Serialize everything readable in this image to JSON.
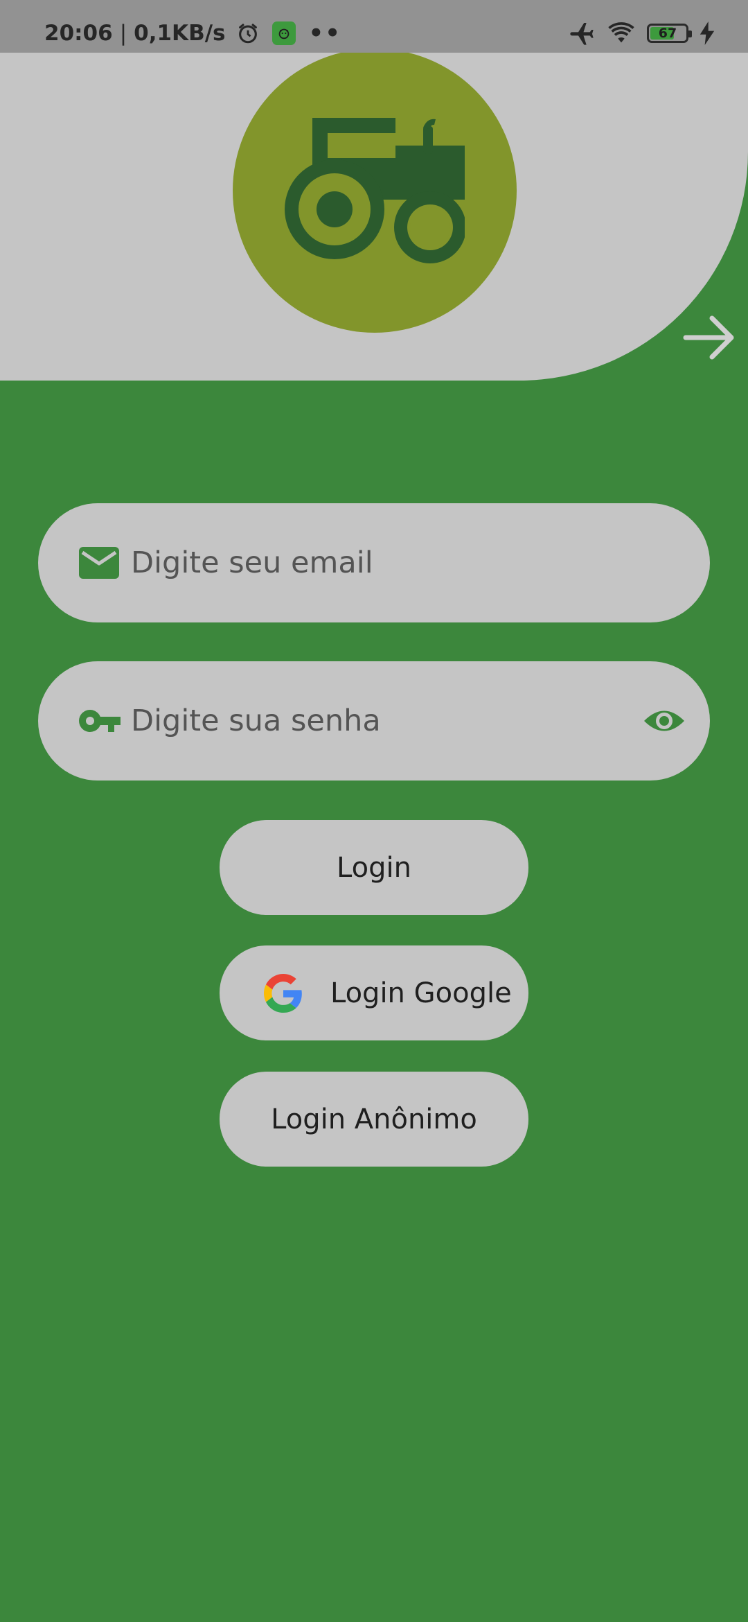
{
  "status_bar": {
    "time": "20:06",
    "separator": "|",
    "data_rate": "0,1KB/s",
    "overflow_dots": "••",
    "battery_percent": "67",
    "battery_level": 0.67
  },
  "header": {
    "logo_icon": "tractor-icon",
    "next_icon": "arrow-right-icon"
  },
  "form": {
    "email": {
      "icon": "email-icon",
      "placeholder": "Digite seu email",
      "value": ""
    },
    "password": {
      "icon": "key-icon",
      "placeholder": "Digite sua senha",
      "value": "",
      "toggle_icon": "eye-icon"
    }
  },
  "buttons": {
    "login_label": "Login",
    "google_label": "Login Google",
    "anonymous_label": "Login Anônimo"
  },
  "colors": {
    "background": "#3c873c",
    "header": "#c5c5c5",
    "logo_circle": "#82952b",
    "logo_tractor": "#2b5b2d",
    "field": "#c5c5c5",
    "icon_green": "#3c873c"
  }
}
